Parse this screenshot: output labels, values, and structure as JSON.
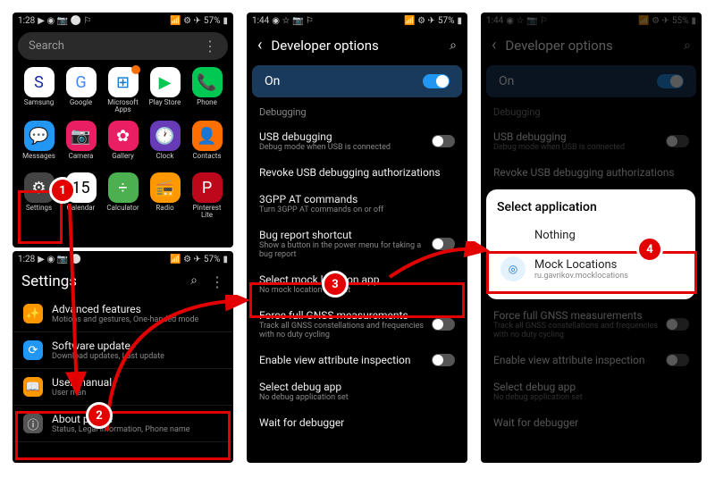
{
  "status": {
    "time1": "1:28",
    "time2": "1:44",
    "time3": "1:44",
    "battery1": "57%",
    "battery2": "57%",
    "battery3": "55%"
  },
  "search": {
    "placeholder": "Search"
  },
  "apps": {
    "r1": [
      {
        "label": "Samsung",
        "bg": "#fff",
        "icon": "S",
        "fg": "#1428a0"
      },
      {
        "label": "Google",
        "bg": "#fff",
        "icon": "G",
        "fg": "#4285f4"
      },
      {
        "label": "Microsoft Apps",
        "bg": "#fff",
        "icon": "⊞",
        "fg": "#0078d4",
        "badge": true
      },
      {
        "label": "Play Store",
        "bg": "#fff",
        "icon": "▶",
        "fg": "#00c853"
      },
      {
        "label": "Phone",
        "bg": "#00c853",
        "icon": "📞",
        "fg": "#fff"
      }
    ],
    "r2": [
      {
        "label": "Messages",
        "bg": "#2196f3",
        "icon": "💬",
        "fg": "#fff"
      },
      {
        "label": "Camera",
        "bg": "#e91e63",
        "icon": "📷",
        "fg": "#fff"
      },
      {
        "label": "Gallery",
        "bg": "#e91e63",
        "icon": "✿",
        "fg": "#fff"
      },
      {
        "label": "Clock",
        "bg": "#673ab7",
        "icon": "🕐",
        "fg": "#fff"
      },
      {
        "label": "Contacts",
        "bg": "#ff6f00",
        "icon": "👤",
        "fg": "#fff"
      }
    ],
    "r3": [
      {
        "label": "Settings",
        "bg": "#444",
        "icon": "⚙",
        "fg": "#fff"
      },
      {
        "label": "Calendar",
        "bg": "#fff",
        "icon": "15",
        "fg": "#000"
      },
      {
        "label": "Calculator",
        "bg": "#4caf50",
        "icon": "÷",
        "fg": "#fff"
      },
      {
        "label": "Radio",
        "bg": "#ff9800",
        "icon": "📻",
        "fg": "#fff"
      },
      {
        "label": "Pinterest Lite",
        "bg": "#bd081c",
        "icon": "P",
        "fg": "#fff"
      }
    ]
  },
  "settingsHdr": "Settings",
  "settings": [
    {
      "title": "Advanced features",
      "sub": "Motions and gestures, One-handed mode",
      "icon": "✨",
      "bg": "#ff9800"
    },
    {
      "title": "Software update",
      "sub": "Download updates, Last update",
      "icon": "⟳",
      "bg": "#2196f3"
    },
    {
      "title": "User manual",
      "sub": "User man",
      "icon": "📖",
      "bg": "#ff9800"
    },
    {
      "title": "About phone",
      "sub": "Status, Legal information, Phone name",
      "icon": "ⓘ",
      "bg": "#555"
    }
  ],
  "devHdr": "Developer options",
  "onLabel": "On",
  "debugLabel": "Debugging",
  "devItems": [
    {
      "title": "USB debugging",
      "sub": "Debug mode when USB is connected",
      "tog": "off"
    },
    {
      "title": "Revoke USB debugging authorizations",
      "sub": ""
    },
    {
      "title": "3GPP AT commands",
      "sub": "Turn 3GPP AT commands on or off"
    },
    {
      "title": "Bug report shortcut",
      "sub": "Show a button in the power menu for taking a bug report",
      "tog": "off"
    },
    {
      "title": "Select mock location app",
      "sub": "No mock location app set"
    },
    {
      "title": "Force full GNSS measurements",
      "sub": "Track all GNSS constellations and frequencies with no duty cycling",
      "tog": "off"
    },
    {
      "title": "Enable view attribute inspection",
      "sub": "",
      "tog": "off"
    },
    {
      "title": "Select debug app",
      "sub": "No debug application set"
    },
    {
      "title": "Wait for debugger",
      "sub": ""
    }
  ],
  "modal": {
    "title": "Select application",
    "nothing": "Nothing",
    "item": {
      "title": "Mock Locations",
      "sub": "ru.gavrikov.mocklocations"
    }
  }
}
